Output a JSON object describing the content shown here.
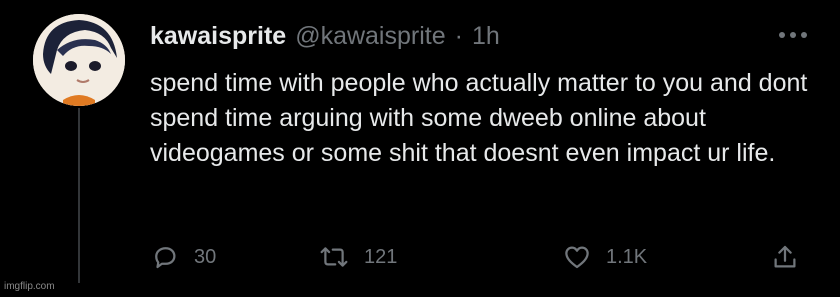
{
  "tweet": {
    "display_name": "kawaisprite",
    "handle": "@kawaisprite",
    "separator": "·",
    "time": "1h",
    "text": "spend time with people who actually matter to you and dont spend time arguing with some dweeb online about videogames or some shit that doesnt even impact ur life.",
    "more_icon": "more-horizontal-icon"
  },
  "actions": {
    "reply": {
      "icon": "reply-bubble-icon",
      "count": "30"
    },
    "retweet": {
      "icon": "retweet-icon",
      "count": "121"
    },
    "like": {
      "icon": "heart-icon",
      "count": "1.1K"
    },
    "share": {
      "icon": "share-icon"
    }
  },
  "watermark": "imgflip.com",
  "colors": {
    "background": "#000000",
    "text_primary": "#e7e9ea",
    "text_secondary": "#71767b"
  }
}
